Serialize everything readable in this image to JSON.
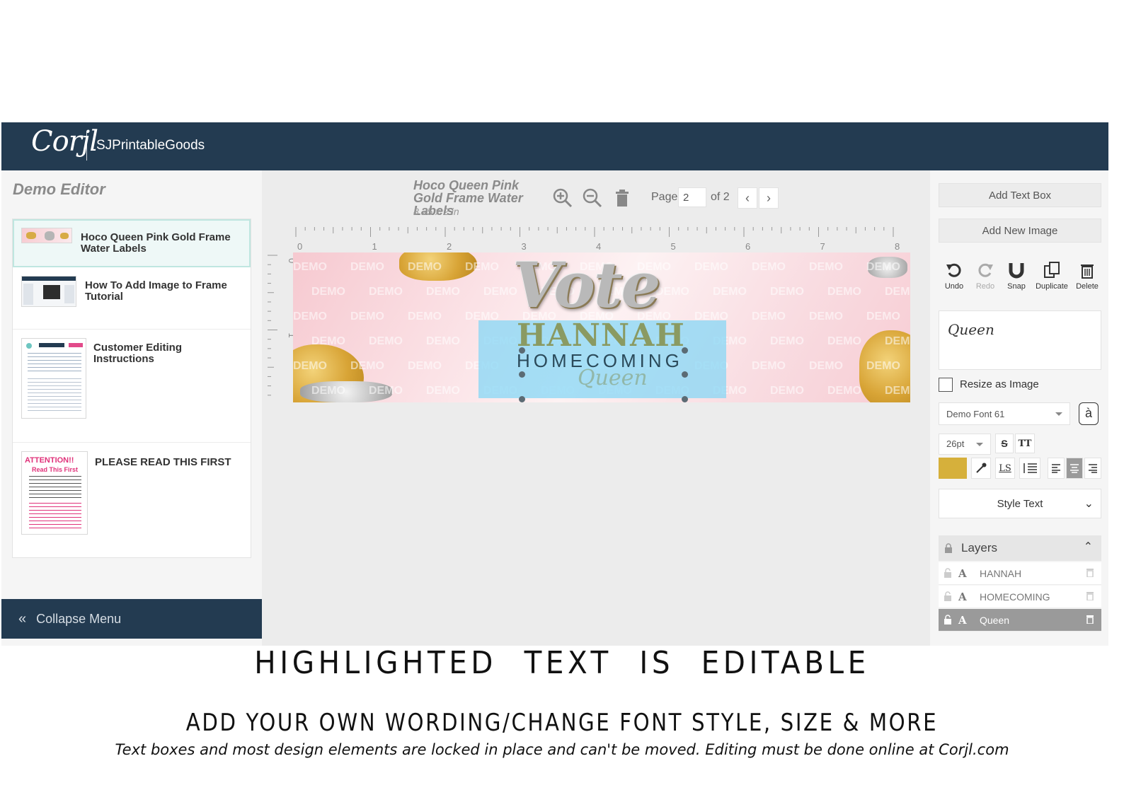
{
  "topbar": {
    "logo": "Corjl",
    "brand": "SJPrintableGoods"
  },
  "sidebar": {
    "title": "Demo Editor",
    "templates": [
      {
        "label": "Hoco Queen Pink Gold Frame Water Labels",
        "selected": true
      },
      {
        "label": "How To Add Image to Frame Tutorial",
        "selected": false
      },
      {
        "label": "Customer Editing Instructions",
        "selected": false
      },
      {
        "label": "PLEASE READ THIS FIRST",
        "selected": false
      }
    ],
    "thumb_attention": {
      "headline": "ATTENTION!!",
      "sub": "Read This First"
    },
    "collapse_label": "Collapse Menu"
  },
  "canvas": {
    "doc_title": "Hoco Queen Pink Gold Frame Water Labels",
    "doc_size": "8.25 x 2 in",
    "page_label": "Page",
    "page_value": "2",
    "page_of": "of 2",
    "ruler_top": [
      "0",
      "1",
      "2",
      "3",
      "4",
      "5",
      "6",
      "7",
      "8"
    ],
    "ruler_left": [
      "0",
      "1"
    ],
    "watermark": "DEMO",
    "design": {
      "vote": "Vote",
      "name": "HANNAH",
      "line2": "HOMECOMING",
      "line3": "Queen"
    }
  },
  "right_panel": {
    "add_text_box": "Add Text Box",
    "add_new_image": "Add New Image",
    "tools": [
      {
        "label": "Undo",
        "icon": "undo-icon",
        "enabled": true
      },
      {
        "label": "Redo",
        "icon": "redo-icon",
        "enabled": false
      },
      {
        "label": "Snap",
        "icon": "magnet-icon",
        "enabled": true
      },
      {
        "label": "Duplicate",
        "icon": "duplicate-icon",
        "enabled": true
      },
      {
        "label": "Delete",
        "icon": "trash-icon",
        "enabled": true
      }
    ],
    "preview_text": "Queen",
    "resize_label": "Resize as Image",
    "font_name": "Demo Font 61",
    "font_size": "26pt",
    "text_color": "#d6b03b",
    "style_text": "Style Text",
    "layers_title": "Layers",
    "layers": [
      {
        "name": "HANNAH",
        "active": false
      },
      {
        "name": "HOMECOMING",
        "active": false
      },
      {
        "name": "Queen",
        "active": true
      }
    ]
  },
  "captions": {
    "line1": "HIGHLIGHTED TEXT IS EDITABLE",
    "line2": "ADD YOUR OWN WORDING/CHANGE FONT STYLE, SIZE & MORE",
    "line3": "Text boxes and most design elements are locked in place and can't be moved. Editing must be done online at Corjl.com"
  }
}
